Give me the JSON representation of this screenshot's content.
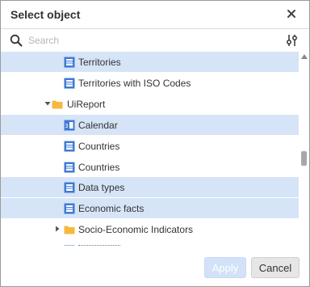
{
  "dialog": {
    "title": "Select object",
    "search_placeholder": "Search",
    "buttons": {
      "apply": "Apply",
      "cancel": "Cancel"
    }
  },
  "tree": [
    {
      "label": "Territories",
      "icon": "table-icon",
      "selected": true
    },
    {
      "label": "Territories with ISO Codes",
      "icon": "table-icon",
      "selected": false
    },
    {
      "label": "UiReport",
      "icon": "folder-icon",
      "expanded": true,
      "selected": false
    },
    {
      "label": "Calendar",
      "icon": "calendar-dictionary-icon",
      "selected": true
    },
    {
      "label": "Countries",
      "icon": "table-icon",
      "selected": false
    },
    {
      "label": "Countries",
      "icon": "table-icon",
      "selected": false
    },
    {
      "label": "Data types",
      "icon": "table-icon",
      "selected": true
    },
    {
      "label": "Economic facts",
      "icon": "table-icon",
      "selected": true
    },
    {
      "label": "Socio-Economic Indicators",
      "icon": "folder-icon",
      "expanded": false,
      "selected": false
    }
  ],
  "colors": {
    "selection": "#d6e4f7",
    "folder": "#f5b940",
    "table_icon": "#3f7bd6",
    "apply_disabled": "#d3e2f8"
  }
}
